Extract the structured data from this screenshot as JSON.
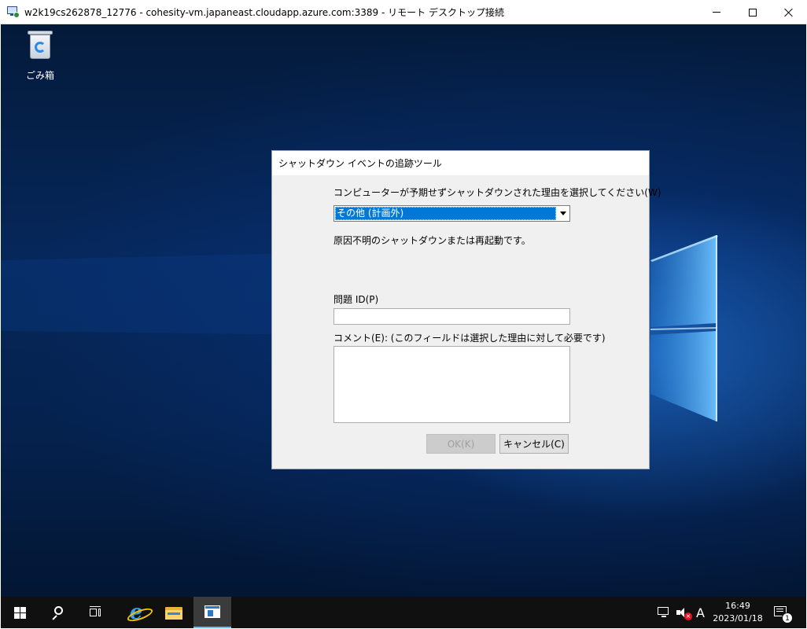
{
  "rdp_window": {
    "title": "w2k19cs262878_12776 - cohesity-vm.japaneast.cloudapp.azure.com:3389 - リモート デスクトップ接続",
    "controls": [
      "minimize",
      "maximize",
      "close"
    ]
  },
  "desktop": {
    "icons": [
      {
        "label": "ごみ箱",
        "icon": "recycle-bin-icon"
      }
    ]
  },
  "dialog": {
    "title": "シャットダウン イベントの追跡ツール",
    "reason_label": "コンピューターが予期せずシャットダウンされた理由を選択してください(W)",
    "reason_selected": "その他 (計画外)",
    "reason_description": "原因不明のシャットダウンまたは再起動です。",
    "problem_id_label": "問題 ID(P)",
    "problem_id_value": "",
    "comment_label": "コメント(E): (このフィールドは選択した理由に対して必要です)",
    "comment_value": "",
    "ok_label": "OK(K)",
    "cancel_label": "キャンセル(C)"
  },
  "taskbar": {
    "items": [
      "start",
      "search",
      "task-view",
      "internet-explorer",
      "file-explorer",
      "shutdown-event-tracker"
    ],
    "ime_indicator": "A",
    "clock_time": "16:49",
    "clock_date": "2023/01/18",
    "notification_count": "1",
    "accent_color": "#76b9ed"
  },
  "colors": {
    "selection": "#0078d7",
    "dialog_bg": "#f0f0f0",
    "taskbar_bg": "#101010"
  }
}
